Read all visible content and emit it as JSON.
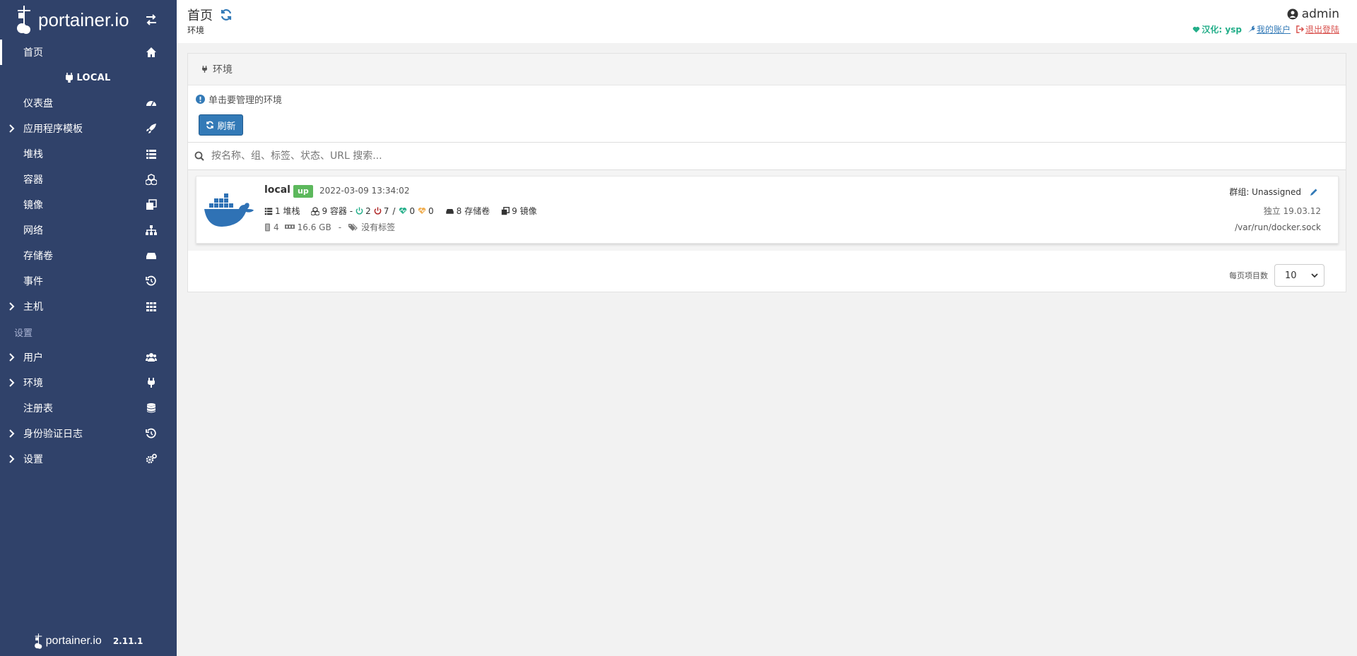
{
  "sidebar": {
    "brand": "portainer.io",
    "items_top": [
      {
        "label": "首页",
        "icon": "home-icon",
        "active": true
      }
    ],
    "endpoint_label": "LOCAL",
    "endpoint_items": [
      {
        "label": "仪表盘",
        "icon": "tachometer-icon"
      },
      {
        "label": "应用程序模板",
        "icon": "rocket-icon",
        "expandable": true
      },
      {
        "label": "堆栈",
        "icon": "list-icon"
      },
      {
        "label": "容器",
        "icon": "cubes-icon"
      },
      {
        "label": "镜像",
        "icon": "clone-icon"
      },
      {
        "label": "网络",
        "icon": "sitemap-icon"
      },
      {
        "label": "存储卷",
        "icon": "hdd-icon"
      },
      {
        "label": "事件",
        "icon": "history-icon"
      },
      {
        "label": "主机",
        "icon": "th-icon",
        "expandable": true
      }
    ],
    "settings_header": "设置",
    "settings_items": [
      {
        "label": "用户",
        "icon": "users-icon",
        "expandable": true
      },
      {
        "label": "环境",
        "icon": "plug-icon",
        "expandable": true
      },
      {
        "label": "注册表",
        "icon": "database-icon"
      },
      {
        "label": "身份验证日志",
        "icon": "history-icon",
        "expandable": true
      },
      {
        "label": "设置",
        "icon": "cogs-icon",
        "expandable": true
      }
    ],
    "footer_brand": "portainer.io",
    "version": "2.11.1"
  },
  "header": {
    "title": "首页",
    "breadcrumb": "环境",
    "username": "admin",
    "hanhua": "汉化: ysp",
    "my_account": "我的账户",
    "logout": "退出登陆"
  },
  "widget": {
    "title": "环境",
    "hint": "单击要管理的环境",
    "refresh_label": "刷新",
    "search_placeholder": "按名称、组、标签、状态、URL 搜索...",
    "items_per_page_label": "每页项目数",
    "items_per_page": "10"
  },
  "endpoint": {
    "name": "local",
    "status": "up",
    "timestamp": "2022-03-09 13:34:02",
    "stacks": "1 堆栈",
    "containers": "9 容器 -",
    "running": "2",
    "stopped": "7",
    "separator": "/",
    "healthy": "0",
    "unhealthy": "0",
    "volumes": "8 存储卷",
    "images": "9 镜像",
    "cpu": "4",
    "memory": "16.6 GB",
    "dash": "-",
    "tags": "没有标签",
    "group": "群组: Unassigned",
    "version": "独立 19.03.12",
    "socket": "/var/run/docker.sock"
  },
  "colors": {
    "sidebar_bg": "#30426a",
    "primary": "#337ab7",
    "success": "#5cb85c",
    "running": "#23ae89",
    "stopped": "#ae2323",
    "unhealthy": "#f0ad4e",
    "docker_blue": "#2f72b5"
  }
}
